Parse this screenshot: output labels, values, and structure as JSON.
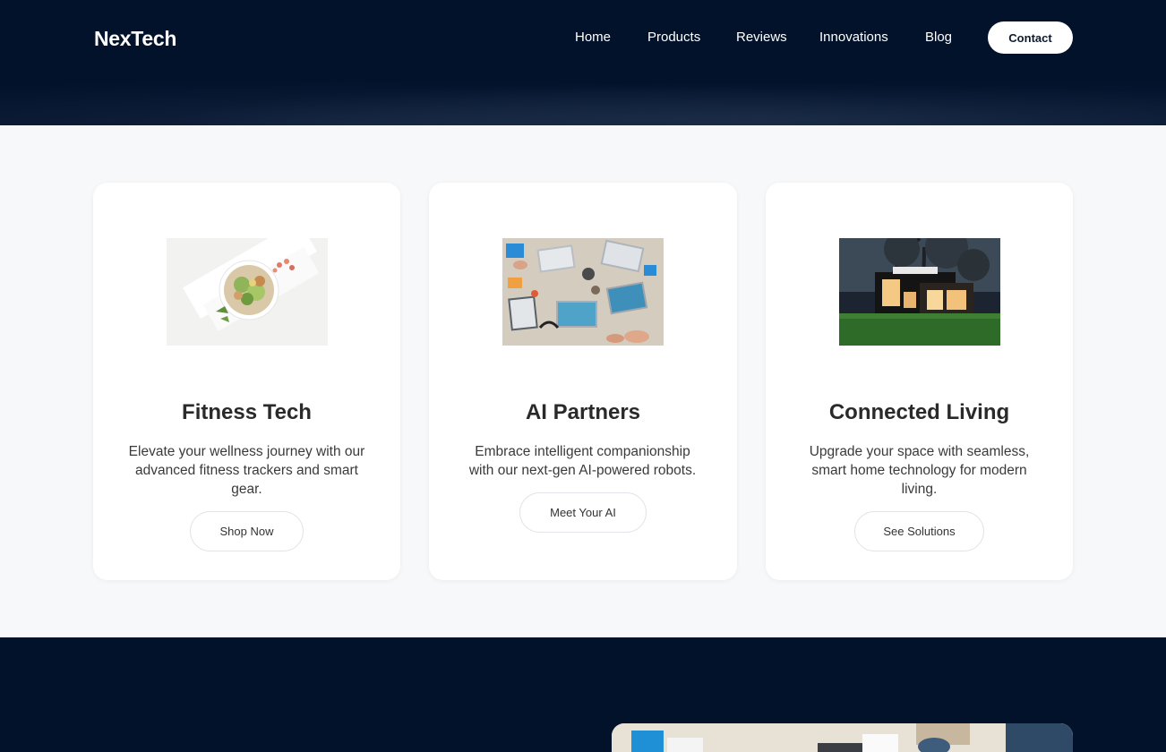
{
  "header": {
    "logo": "NexTech",
    "nav": [
      "Home",
      "Products",
      "Reviews",
      "Innovations",
      "Blog"
    ],
    "contact_label": "Contact"
  },
  "cards": [
    {
      "title": "Fitness Tech",
      "description": "Elevate your wellness journey with our advanced fitness trackers and smart gear.",
      "button": "Shop Now",
      "image": "salad-bowl-photo"
    },
    {
      "title": "AI Partners",
      "description": "Embrace intelligent companionship with our next-gen AI-powered robots.",
      "button": "Meet Your AI",
      "image": "team-laptops-photo"
    },
    {
      "title": "Connected Living",
      "description": "Upgrade your space with seamless, smart home technology for modern living.",
      "button": "See Solutions",
      "image": "modern-house-photo"
    }
  ],
  "colors": {
    "navy": "#03122b",
    "page_bg": "#f6f8fa",
    "card_bg": "#ffffff",
    "text_dark": "#2a2a2a"
  }
}
